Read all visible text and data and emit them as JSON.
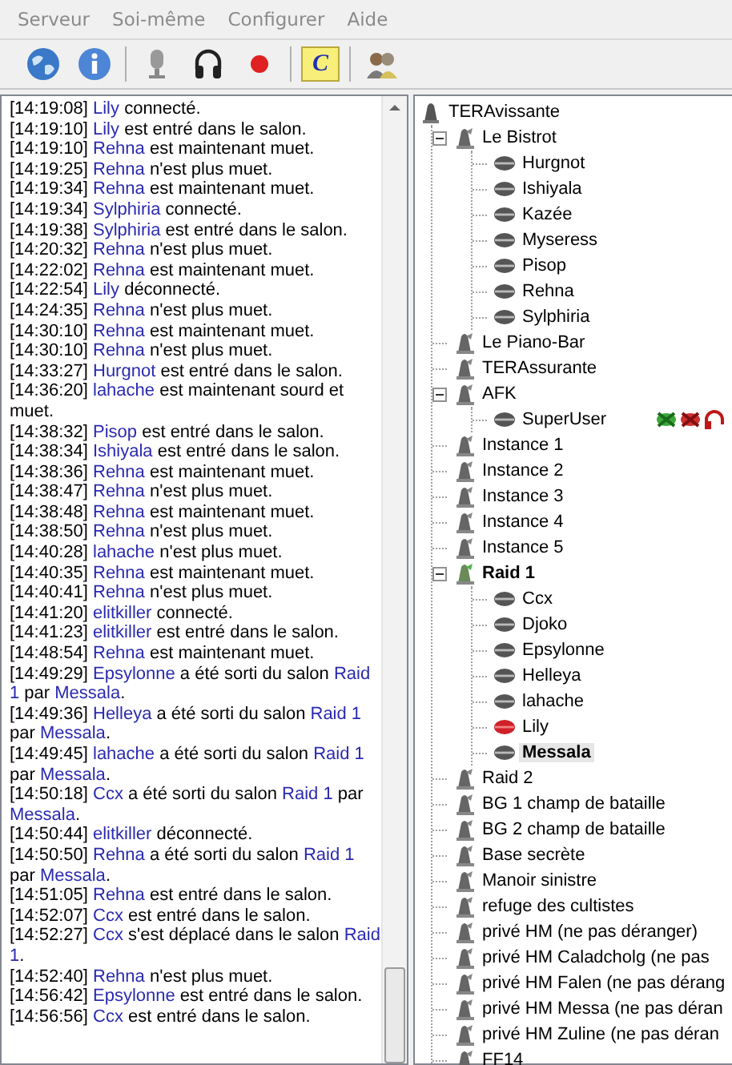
{
  "menu": [
    {
      "label": "Serveur"
    },
    {
      "label": "Soi-même"
    },
    {
      "label": "Configurer"
    },
    {
      "label": "Aide"
    }
  ],
  "toolbar": [
    {
      "kind": "globe"
    },
    {
      "kind": "info"
    },
    {
      "kind": "separator"
    },
    {
      "kind": "microphone"
    },
    {
      "kind": "headphones"
    },
    {
      "kind": "record"
    },
    {
      "kind": "separator"
    },
    {
      "kind": "comment",
      "label": "C"
    },
    {
      "kind": "separator"
    },
    {
      "kind": "users"
    }
  ],
  "log": [
    {
      "time": "[14:19:08]",
      "parts": [
        {
          "kind": "name",
          "text": "Lily"
        },
        {
          "kind": "text",
          "text": " connecté."
        }
      ]
    },
    {
      "time": "[14:19:10]",
      "parts": [
        {
          "kind": "name",
          "text": "Lily"
        },
        {
          "kind": "text",
          "text": " est entré dans le salon."
        }
      ]
    },
    {
      "time": "[14:19:10]",
      "parts": [
        {
          "kind": "name",
          "text": "Rehna"
        },
        {
          "kind": "text",
          "text": " est maintenant muet."
        }
      ]
    },
    {
      "time": "[14:19:25]",
      "parts": [
        {
          "kind": "name",
          "text": "Rehna"
        },
        {
          "kind": "text",
          "text": " n'est plus muet."
        }
      ]
    },
    {
      "time": "[14:19:34]",
      "parts": [
        {
          "kind": "name",
          "text": "Rehna"
        },
        {
          "kind": "text",
          "text": " est maintenant muet."
        }
      ]
    },
    {
      "time": "[14:19:34]",
      "parts": [
        {
          "kind": "name",
          "text": "Sylphiria"
        },
        {
          "kind": "text",
          "text": " connecté."
        }
      ]
    },
    {
      "time": "[14:19:38]",
      "parts": [
        {
          "kind": "name",
          "text": "Sylphiria"
        },
        {
          "kind": "text",
          "text": " est entré dans le salon."
        }
      ]
    },
    {
      "time": "[14:20:32]",
      "parts": [
        {
          "kind": "name",
          "text": "Rehna"
        },
        {
          "kind": "text",
          "text": " n'est plus muet."
        }
      ]
    },
    {
      "time": "[14:22:02]",
      "parts": [
        {
          "kind": "name",
          "text": "Rehna"
        },
        {
          "kind": "text",
          "text": " est maintenant muet."
        }
      ]
    },
    {
      "time": "[14:22:54]",
      "parts": [
        {
          "kind": "name",
          "text": "Lily"
        },
        {
          "kind": "text",
          "text": " déconnecté."
        }
      ]
    },
    {
      "time": "[14:24:35]",
      "parts": [
        {
          "kind": "name",
          "text": "Rehna"
        },
        {
          "kind": "text",
          "text": " n'est plus muet."
        }
      ]
    },
    {
      "time": "[14:30:10]",
      "parts": [
        {
          "kind": "name",
          "text": "Rehna"
        },
        {
          "kind": "text",
          "text": " est maintenant muet."
        }
      ]
    },
    {
      "time": "[14:30:10]",
      "parts": [
        {
          "kind": "name",
          "text": "Rehna"
        },
        {
          "kind": "text",
          "text": " n'est plus muet."
        }
      ]
    },
    {
      "time": "[14:33:27]",
      "parts": [
        {
          "kind": "name",
          "text": "Hurgnot"
        },
        {
          "kind": "text",
          "text": " est entré dans le salon."
        }
      ]
    },
    {
      "time": "[14:36:20]",
      "parts": [
        {
          "kind": "name",
          "text": "lahache"
        },
        {
          "kind": "text",
          "text": " est maintenant sourd et muet."
        }
      ]
    },
    {
      "time": "[14:38:32]",
      "parts": [
        {
          "kind": "name",
          "text": "Pisop"
        },
        {
          "kind": "text",
          "text": " est entré dans le salon."
        }
      ]
    },
    {
      "time": "[14:38:34]",
      "parts": [
        {
          "kind": "name",
          "text": "Ishiyala"
        },
        {
          "kind": "text",
          "text": " est entré dans le salon."
        }
      ]
    },
    {
      "time": "[14:38:36]",
      "parts": [
        {
          "kind": "name",
          "text": "Rehna"
        },
        {
          "kind": "text",
          "text": " est maintenant muet."
        }
      ]
    },
    {
      "time": "[14:38:47]",
      "parts": [
        {
          "kind": "name",
          "text": "Rehna"
        },
        {
          "kind": "text",
          "text": " n'est plus muet."
        }
      ]
    },
    {
      "time": "[14:38:48]",
      "parts": [
        {
          "kind": "name",
          "text": "Rehna"
        },
        {
          "kind": "text",
          "text": " est maintenant muet."
        }
      ]
    },
    {
      "time": "[14:38:50]",
      "parts": [
        {
          "kind": "name",
          "text": "Rehna"
        },
        {
          "kind": "text",
          "text": " n'est plus muet."
        }
      ]
    },
    {
      "time": "[14:40:28]",
      "parts": [
        {
          "kind": "name",
          "text": "lahache"
        },
        {
          "kind": "text",
          "text": " n'est plus muet."
        }
      ]
    },
    {
      "time": "[14:40:35]",
      "parts": [
        {
          "kind": "name",
          "text": "Rehna"
        },
        {
          "kind": "text",
          "text": " est maintenant muet."
        }
      ]
    },
    {
      "time": "[14:40:41]",
      "parts": [
        {
          "kind": "name",
          "text": "Rehna"
        },
        {
          "kind": "text",
          "text": " n'est plus muet."
        }
      ]
    },
    {
      "time": "[14:41:20]",
      "parts": [
        {
          "kind": "name",
          "text": "elitkiller"
        },
        {
          "kind": "text",
          "text": " connecté."
        }
      ]
    },
    {
      "time": "[14:41:23]",
      "parts": [
        {
          "kind": "name",
          "text": "elitkiller"
        },
        {
          "kind": "text",
          "text": " est entré dans le salon."
        }
      ]
    },
    {
      "time": "[14:48:54]",
      "parts": [
        {
          "kind": "name",
          "text": "Rehna"
        },
        {
          "kind": "text",
          "text": " est maintenant muet."
        }
      ]
    },
    {
      "time": "[14:49:29]",
      "parts": [
        {
          "kind": "name",
          "text": "Epsylonne"
        },
        {
          "kind": "text",
          "text": " a été sorti du salon "
        },
        {
          "kind": "name",
          "text": "Raid 1"
        },
        {
          "kind": "text",
          "text": " par "
        },
        {
          "kind": "name",
          "text": "Messala"
        },
        {
          "kind": "text",
          "text": "."
        }
      ]
    },
    {
      "time": "[14:49:36]",
      "parts": [
        {
          "kind": "name",
          "text": "Helleya"
        },
        {
          "kind": "text",
          "text": " a été sorti du salon "
        },
        {
          "kind": "name",
          "text": "Raid 1"
        },
        {
          "kind": "text",
          "text": " par "
        },
        {
          "kind": "name",
          "text": "Messala"
        },
        {
          "kind": "text",
          "text": "."
        }
      ]
    },
    {
      "time": "[14:49:45]",
      "parts": [
        {
          "kind": "name",
          "text": "lahache"
        },
        {
          "kind": "text",
          "text": " a été sorti du salon "
        },
        {
          "kind": "name",
          "text": "Raid 1"
        },
        {
          "kind": "text",
          "text": " par "
        },
        {
          "kind": "name",
          "text": "Messala"
        },
        {
          "kind": "text",
          "text": "."
        }
      ]
    },
    {
      "time": "[14:50:18]",
      "parts": [
        {
          "kind": "name",
          "text": "Ccx"
        },
        {
          "kind": "text",
          "text": " a été sorti du salon "
        },
        {
          "kind": "name",
          "text": "Raid 1"
        },
        {
          "kind": "text",
          "text": " par "
        },
        {
          "kind": "name",
          "text": "Messala"
        },
        {
          "kind": "text",
          "text": "."
        }
      ]
    },
    {
      "time": "[14:50:44]",
      "parts": [
        {
          "kind": "name",
          "text": "elitkiller"
        },
        {
          "kind": "text",
          "text": " déconnecté."
        }
      ]
    },
    {
      "time": "[14:50:50]",
      "parts": [
        {
          "kind": "name",
          "text": "Rehna"
        },
        {
          "kind": "text",
          "text": " a été sorti du salon "
        },
        {
          "kind": "name",
          "text": "Raid 1"
        },
        {
          "kind": "text",
          "text": " par "
        },
        {
          "kind": "name",
          "text": "Messala"
        },
        {
          "kind": "text",
          "text": "."
        }
      ]
    },
    {
      "time": "[14:51:05]",
      "parts": [
        {
          "kind": "name",
          "text": "Rehna"
        },
        {
          "kind": "text",
          "text": " est entré dans le salon."
        }
      ]
    },
    {
      "time": "[14:52:07]",
      "parts": [
        {
          "kind": "name",
          "text": "Ccx"
        },
        {
          "kind": "text",
          "text": " est entré dans le salon."
        }
      ]
    },
    {
      "time": "[14:52:27]",
      "parts": [
        {
          "kind": "name",
          "text": "Ccx"
        },
        {
          "kind": "text",
          "text": " s'est déplacé dans le salon "
        },
        {
          "kind": "name",
          "text": "Raid 1"
        },
        {
          "kind": "text",
          "text": "."
        }
      ]
    },
    {
      "time": "[14:52:40]",
      "parts": [
        {
          "kind": "name",
          "text": "Rehna"
        },
        {
          "kind": "text",
          "text": " n'est plus muet."
        }
      ]
    },
    {
      "time": "[14:56:42]",
      "parts": [
        {
          "kind": "name",
          "text": "Epsylonne"
        },
        {
          "kind": "text",
          "text": " est entré dans le salon."
        }
      ]
    },
    {
      "time": "[14:56:56]",
      "parts": [
        {
          "kind": "name",
          "text": "Ccx"
        },
        {
          "kind": "text",
          "text": " est entré dans le salon."
        }
      ]
    }
  ],
  "tree": {
    "kind": "server",
    "name": "TERAvissante",
    "children": [
      {
        "kind": "channel",
        "name": "Le Bistrot",
        "expanded": true,
        "children": [
          {
            "kind": "user",
            "name": "Hurgnot"
          },
          {
            "kind": "user",
            "name": "Ishiyala"
          },
          {
            "kind": "user",
            "name": "Kazée"
          },
          {
            "kind": "user",
            "name": "Myseress"
          },
          {
            "kind": "user",
            "name": "Pisop"
          },
          {
            "kind": "user",
            "name": "Rehna"
          },
          {
            "kind": "user",
            "name": "Sylphiria"
          }
        ]
      },
      {
        "kind": "channel",
        "name": "Le Piano-Bar"
      },
      {
        "kind": "channel",
        "name": "TERAssurante"
      },
      {
        "kind": "channel",
        "name": "AFK",
        "expanded": true,
        "children": [
          {
            "kind": "user",
            "name": "SuperUser",
            "flags": [
              {
                "kind": "server-muted"
              },
              {
                "kind": "self-muted"
              },
              {
                "kind": "deafened"
              }
            ]
          }
        ]
      },
      {
        "kind": "channel",
        "name": "Instance 1"
      },
      {
        "kind": "channel",
        "name": "Instance 2"
      },
      {
        "kind": "channel",
        "name": "Instance 3"
      },
      {
        "kind": "channel",
        "name": "Instance 4"
      },
      {
        "kind": "channel",
        "name": "Instance 5"
      },
      {
        "kind": "channel",
        "name": "Raid 1",
        "expanded": true,
        "current": true,
        "children": [
          {
            "kind": "user",
            "name": "Ccx"
          },
          {
            "kind": "user",
            "name": "Djoko"
          },
          {
            "kind": "user",
            "name": "Epsylonne"
          },
          {
            "kind": "user",
            "name": "Helleya"
          },
          {
            "kind": "user",
            "name": "lahache"
          },
          {
            "kind": "user",
            "name": "Lily",
            "talking": true
          },
          {
            "kind": "user",
            "name": "Messala",
            "selected": true
          }
        ]
      },
      {
        "kind": "channel",
        "name": "Raid 2"
      },
      {
        "kind": "channel",
        "name": "BG 1 champ de bataille"
      },
      {
        "kind": "channel",
        "name": "BG 2 champ de bataille"
      },
      {
        "kind": "channel",
        "name": "Base secrète"
      },
      {
        "kind": "channel",
        "name": "Manoir sinistre"
      },
      {
        "kind": "channel",
        "name": "refuge des cultistes"
      },
      {
        "kind": "channel",
        "name": "privé HM (ne pas déranger)"
      },
      {
        "kind": "channel",
        "name": "privé HM Caladcholg (ne pas"
      },
      {
        "kind": "channel",
        "name": "privé HM Falen (ne pas dérang"
      },
      {
        "kind": "channel",
        "name": "privé HM Messa (ne pas déran"
      },
      {
        "kind": "channel",
        "name": "privé HM Zuline (ne pas déran"
      },
      {
        "kind": "channel",
        "name": "FF14"
      }
    ]
  }
}
